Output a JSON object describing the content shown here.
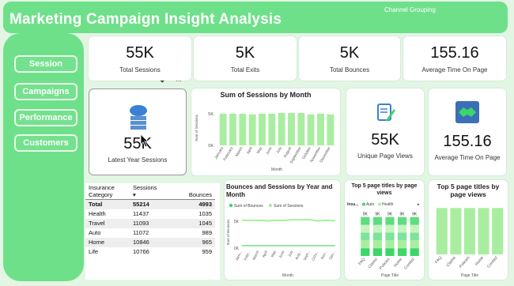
{
  "header": {
    "title": "Marketing Campaign Insight Analysis",
    "channel_label": "Channel Grouping"
  },
  "sidebar": {
    "items": [
      {
        "label": "Session"
      },
      {
        "label": "Campaigns"
      },
      {
        "label": "Performance"
      },
      {
        "label": "Customers"
      }
    ]
  },
  "kpis": [
    {
      "value": "55K",
      "label": "Total Sessions"
    },
    {
      "value": "5K",
      "label": "Total Exits"
    },
    {
      "value": "5K",
      "label": "Total Bounces"
    },
    {
      "value": "155.16",
      "label": "Average Time On Page"
    }
  ],
  "latest_year": {
    "value": "55K",
    "label": "Latest Year Sessions"
  },
  "unique_views": {
    "value": "55K",
    "label": "Unique Page Views"
  },
  "avg_time": {
    "value": "155.16",
    "label": "Average Time On Page"
  },
  "colors": {
    "accent": "#6fe08a",
    "bar": "#a9eea0",
    "bar_dark": "#3dd66a",
    "line": "#a9eea0",
    "icon_blue": "#3b7fd6"
  },
  "table": {
    "headers": [
      "Insurance Category",
      "Sessions",
      "Bounces"
    ],
    "rows": [
      [
        "Total",
        "55214",
        "4993"
      ],
      [
        "Health",
        "11437",
        "1035"
      ],
      [
        "Travel",
        "11093",
        "1045"
      ],
      [
        "Auto",
        "11072",
        "989"
      ],
      [
        "Home",
        "10846",
        "965"
      ],
      [
        "Life",
        "10766",
        "959"
      ]
    ]
  },
  "chart_data": [
    {
      "type": "bar",
      "title": "Sum of Sessions by Month",
      "xlabel": "Month",
      "ylabel": "Sum of Sessions",
      "categories": [
        "January",
        "February",
        "March",
        "April",
        "May",
        "June",
        "July",
        "August",
        "September",
        "October",
        "November",
        "December"
      ],
      "values": [
        4.6,
        4.6,
        4.6,
        4.5,
        4.6,
        4.6,
        4.7,
        4.7,
        4.7,
        4.5,
        4.6,
        4.5
      ],
      "yticks": [
        "0K",
        "5K"
      ],
      "ylim": [
        0,
        5.5
      ]
    },
    {
      "type": "line",
      "title": "Bounces and Sessions by Year and Month",
      "xlabel": "Month",
      "ylabel": "Sum of Bounces",
      "legend": [
        "Sum of Bounces",
        "Sum of Sessions"
      ],
      "categories": [
        "Janu...",
        "Febr...",
        "March",
        "April",
        "May",
        "June",
        "July",
        "Aug...",
        "Sept...",
        "Octo...",
        "Nov...",
        "Dec..."
      ],
      "series": [
        {
          "name": "Sum of Bounces",
          "values": [
            0.4,
            0.4,
            0.4,
            0.4,
            0.4,
            0.4,
            0.4,
            0.4,
            0.4,
            0.4,
            0.4,
            0.4
          ]
        },
        {
          "name": "Sum of Sessions",
          "values": [
            4.6,
            4.6,
            4.6,
            4.5,
            4.6,
            4.6,
            4.7,
            4.7,
            4.7,
            4.5,
            4.6,
            4.5
          ]
        }
      ],
      "yticks": [
        "0K",
        "5K"
      ]
    },
    {
      "type": "bar",
      "title": "Top 5 page titles by page views",
      "legend_title": "Insu...",
      "legend": [
        "Auto",
        "Health"
      ],
      "xlabel": "Page Title",
      "categories": [
        "FAQ",
        "Claims",
        "Policies",
        "Home",
        "Contact"
      ],
      "stacked": true,
      "values": [
        9,
        9,
        9,
        9,
        9
      ],
      "labels": [
        "9K",
        "9K",
        "9K",
        "9K",
        "9K"
      ]
    },
    {
      "type": "bar",
      "title": "Top 5 page titles by page views",
      "xlabel": "Page Title",
      "categories": [
        "FAQ",
        "Claims",
        "Policies",
        "Home",
        "Contact"
      ],
      "values": [
        9,
        9,
        9,
        9,
        9
      ]
    }
  ]
}
